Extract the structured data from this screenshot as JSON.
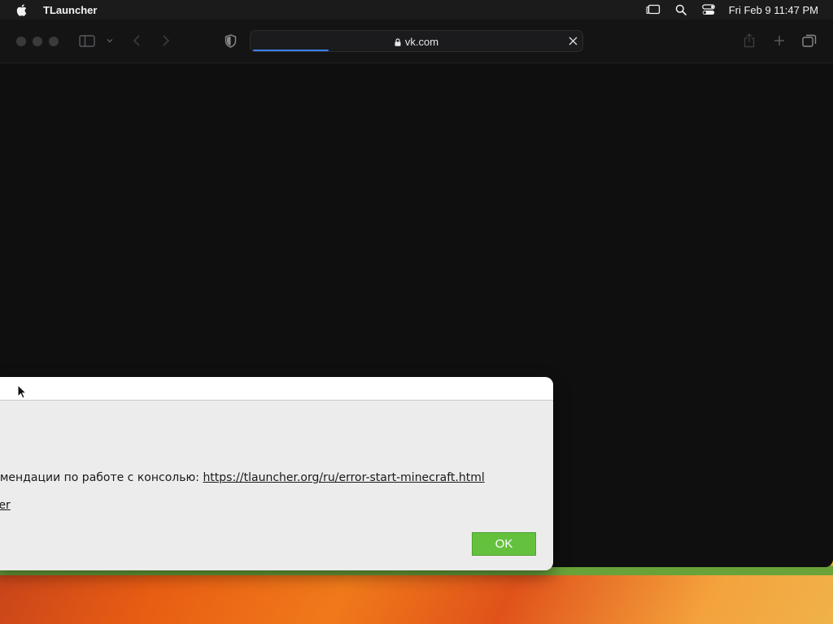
{
  "menubar": {
    "app_name": "TLauncher",
    "clock": "Fri Feb 9  11:47 PM",
    "icons": [
      "apple-logo-icon",
      "stage-manager-icon",
      "spotlight-search-icon",
      "control-center-icon"
    ]
  },
  "browser": {
    "url": "vk.com",
    "loading_progress": 0.23,
    "toolbar_icons": [
      "sidebar-icon",
      "chevron-down-icon",
      "back-arrow-icon",
      "forward-arrow-icon",
      "privacy-shield-icon",
      "lock-icon",
      "stop-loading-icon",
      "share-icon",
      "new-tab-icon",
      "tab-overview-icon"
    ]
  },
  "dialog": {
    "line1_text": "щие рекомендации по работе с консолью: ",
    "line1_link": "https://tlauncher.org/ru/error-start-minecraft.html",
    "line2_link": "ncher",
    "ok_label": "OK"
  },
  "colors": {
    "ok_button": "#64c13d",
    "loading_bar": "#3b82f6",
    "menubar_bg": "#1b1b1c",
    "browser_bg": "#0f0f10",
    "dialog_bg": "#ececec"
  }
}
